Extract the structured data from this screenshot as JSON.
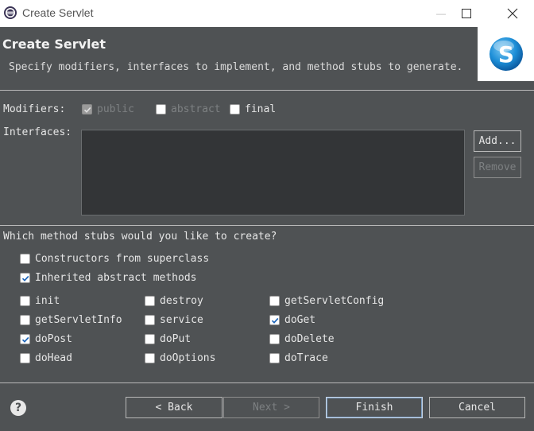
{
  "window": {
    "title": "Create Servlet",
    "minimize_glyph": "—",
    "maximize_glyph": "☐",
    "close_glyph": "✕"
  },
  "header": {
    "title": "Create Servlet",
    "description": "Specify modifiers, interfaces to implement, and method stubs to generate."
  },
  "modifiers": {
    "label": "Modifiers:",
    "public": {
      "label": "public",
      "checked": true,
      "enabled": false
    },
    "abstract": {
      "label": "abstract",
      "checked": false,
      "enabled": false
    },
    "final": {
      "label": "final",
      "checked": false,
      "enabled": true
    }
  },
  "interfaces": {
    "label": "Interfaces:",
    "items": [],
    "add_label": "Add...",
    "remove_label": "Remove"
  },
  "stubs": {
    "question": "Which method stubs would you like to create?",
    "constructors": {
      "label": "Constructors from superclass",
      "checked": false
    },
    "inherited": {
      "label": "Inherited abstract methods",
      "checked": true
    },
    "methods": [
      {
        "label": "init",
        "checked": false
      },
      {
        "label": "destroy",
        "checked": false
      },
      {
        "label": "getServletConfig",
        "checked": false
      },
      {
        "label": "getServletInfo",
        "checked": false
      },
      {
        "label": "service",
        "checked": false
      },
      {
        "label": "doGet",
        "checked": true
      },
      {
        "label": "doPost",
        "checked": true
      },
      {
        "label": "doPut",
        "checked": false
      },
      {
        "label": "doDelete",
        "checked": false
      },
      {
        "label": "doHead",
        "checked": false
      },
      {
        "label": "doOptions",
        "checked": false
      },
      {
        "label": "doTrace",
        "checked": false
      }
    ]
  },
  "footer": {
    "help_glyph": "?",
    "back_label": "< Back",
    "next_label": "Next >",
    "finish_label": "Finish",
    "cancel_label": "Cancel"
  },
  "colors": {
    "background": "#4f5254",
    "check_blue": "#1a63b8",
    "logo_blue": "#1e8fd8"
  }
}
